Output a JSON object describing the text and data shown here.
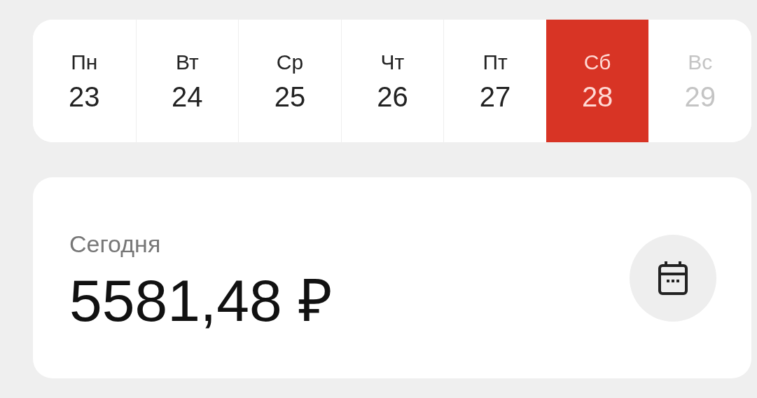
{
  "week": [
    {
      "day": "Пн",
      "date": "23",
      "selected": false,
      "disabled": false
    },
    {
      "day": "Вт",
      "date": "24",
      "selected": false,
      "disabled": false
    },
    {
      "day": "Ср",
      "date": "25",
      "selected": false,
      "disabled": false
    },
    {
      "day": "Чт",
      "date": "26",
      "selected": false,
      "disabled": false
    },
    {
      "day": "Пт",
      "date": "27",
      "selected": false,
      "disabled": false
    },
    {
      "day": "Сб",
      "date": "28",
      "selected": true,
      "disabled": false
    },
    {
      "day": "Вс",
      "date": "29",
      "selected": false,
      "disabled": true
    }
  ],
  "summary": {
    "label": "Сегодня",
    "amount": "5581,48 ₽"
  }
}
